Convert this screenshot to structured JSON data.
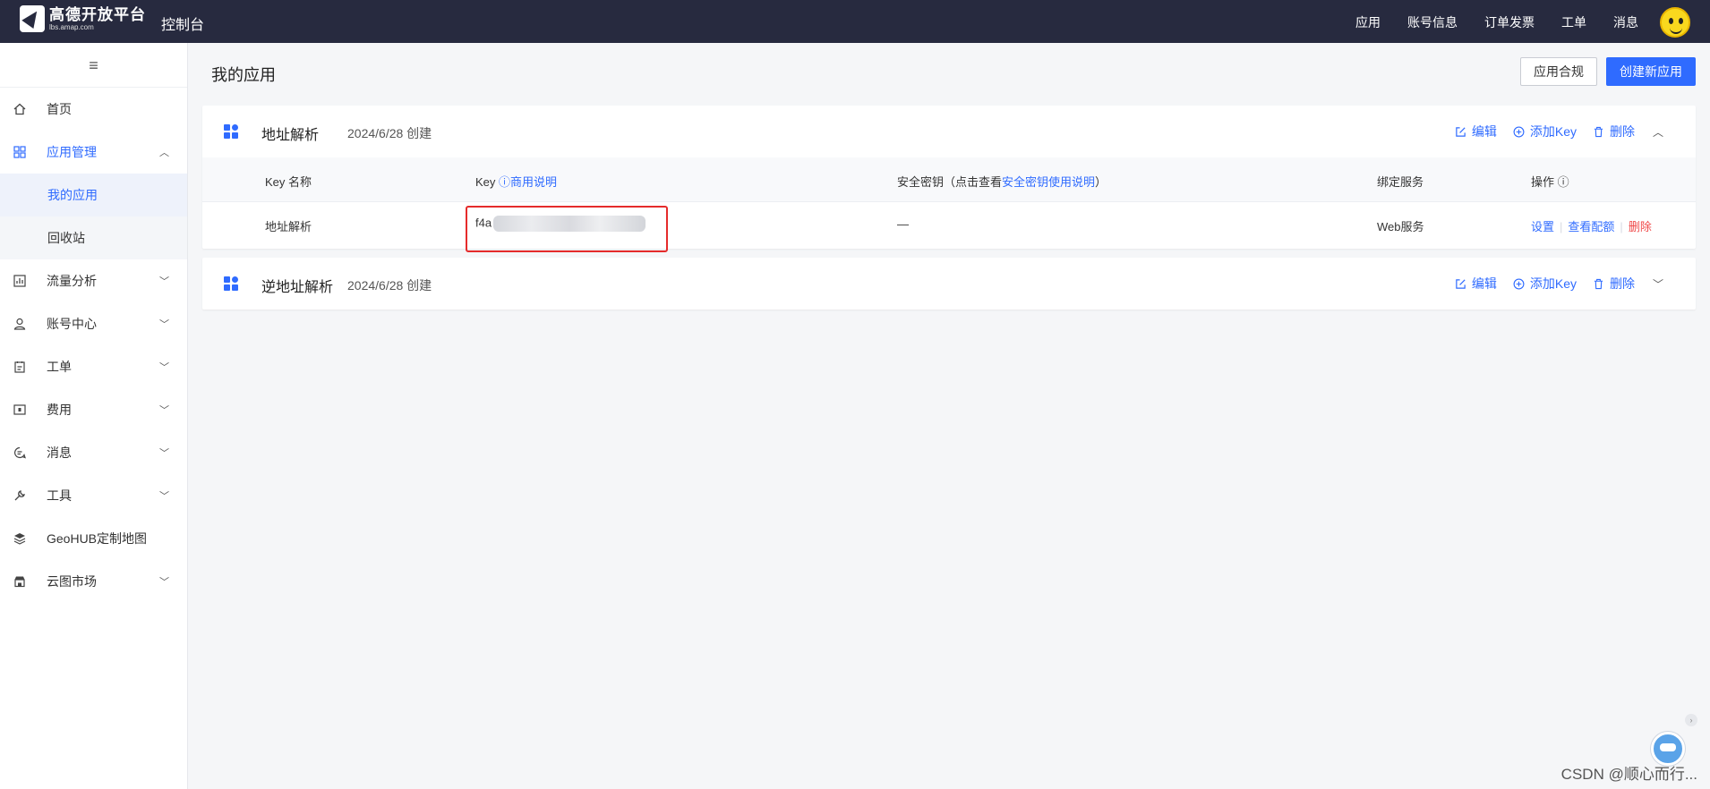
{
  "topbar": {
    "logo_title": "高德开放平台",
    "logo_sub": "lbs.amap.com",
    "console": "控制台",
    "nav": [
      "应用",
      "账号信息",
      "订单发票",
      "工单",
      "消息"
    ]
  },
  "sidebar": {
    "toggle": "≡",
    "items": [
      {
        "label": "首页"
      },
      {
        "label": "应用管理"
      },
      {
        "label": "我的应用"
      },
      {
        "label": "回收站"
      },
      {
        "label": "流量分析"
      },
      {
        "label": "账号中心"
      },
      {
        "label": "工单"
      },
      {
        "label": "费用"
      },
      {
        "label": "消息"
      },
      {
        "label": "工具"
      },
      {
        "label": "GeoHUB定制地图"
      },
      {
        "label": "云图市场"
      }
    ]
  },
  "main": {
    "title": "我的应用",
    "compliance_button": "应用合规",
    "create_button": "创建新应用",
    "apps": [
      {
        "name": "地址解析",
        "date": "2024/6/28 创建",
        "actions": {
          "edit": "编辑",
          "add_key": "添加Key",
          "delete": "删除"
        },
        "table": {
          "headers": {
            "key_name": "Key 名称",
            "key": "Key",
            "key_help": "商用说明",
            "secret_prefix": "安全密钥（点击查看",
            "secret_link": "安全密钥使用说明",
            "secret_suffix": "）",
            "service": "绑定服务",
            "ops": "操作"
          },
          "rows": [
            {
              "name": "地址解析",
              "key": "f4a",
              "secret": "—",
              "service": "Web服务",
              "op_settings": "设置",
              "op_quota": "查看配额",
              "op_delete": "删除"
            }
          ]
        }
      },
      {
        "name": "逆地址解析",
        "date": "2024/6/28 创建",
        "actions": {
          "edit": "编辑",
          "add_key": "添加Key",
          "delete": "删除"
        }
      }
    ]
  },
  "watermark": "CSDN @顺心而行...",
  "colors": {
    "accent": "#2f6bff",
    "topbar": "#272a3f",
    "danger": "#f04848",
    "highlight": "#e52b2b"
  }
}
